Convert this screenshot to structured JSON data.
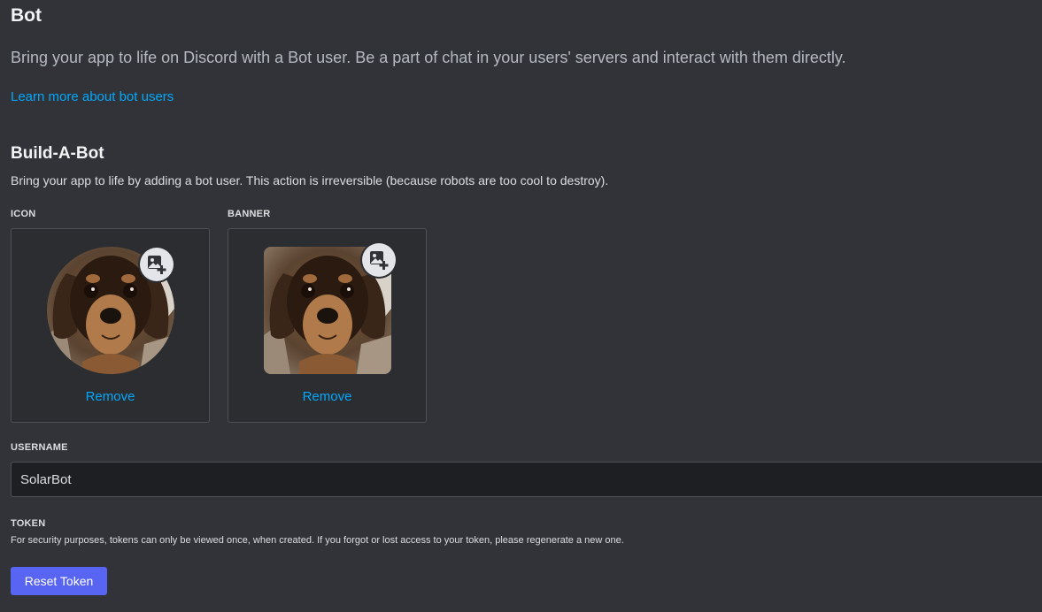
{
  "header": {
    "title": "Bot",
    "description": "Bring your app to life on Discord with a Bot user. Be a part of chat in your users' servers and interact with them directly.",
    "learn_more_link": "Learn more about bot users"
  },
  "build_a_bot": {
    "title": "Build-A-Bot",
    "description": "Bring your app to life by adding a bot user. This action is irreversible (because robots are too cool to destroy)."
  },
  "icon": {
    "label": "ICON",
    "remove_label": "Remove",
    "image_icon": "image-plus-icon"
  },
  "banner": {
    "label": "BANNER",
    "remove_label": "Remove",
    "image_icon": "image-plus-icon"
  },
  "username": {
    "label": "USERNAME",
    "value": "SolarBot"
  },
  "token": {
    "label": "TOKEN",
    "description": "For security purposes, tokens can only be viewed once, when created. If you forgot or lost access to your token, please regenerate a new one.",
    "reset_label": "Reset Token"
  },
  "colors": {
    "background": "#313338",
    "link": "#00a8fc",
    "button": "#5865f2"
  }
}
